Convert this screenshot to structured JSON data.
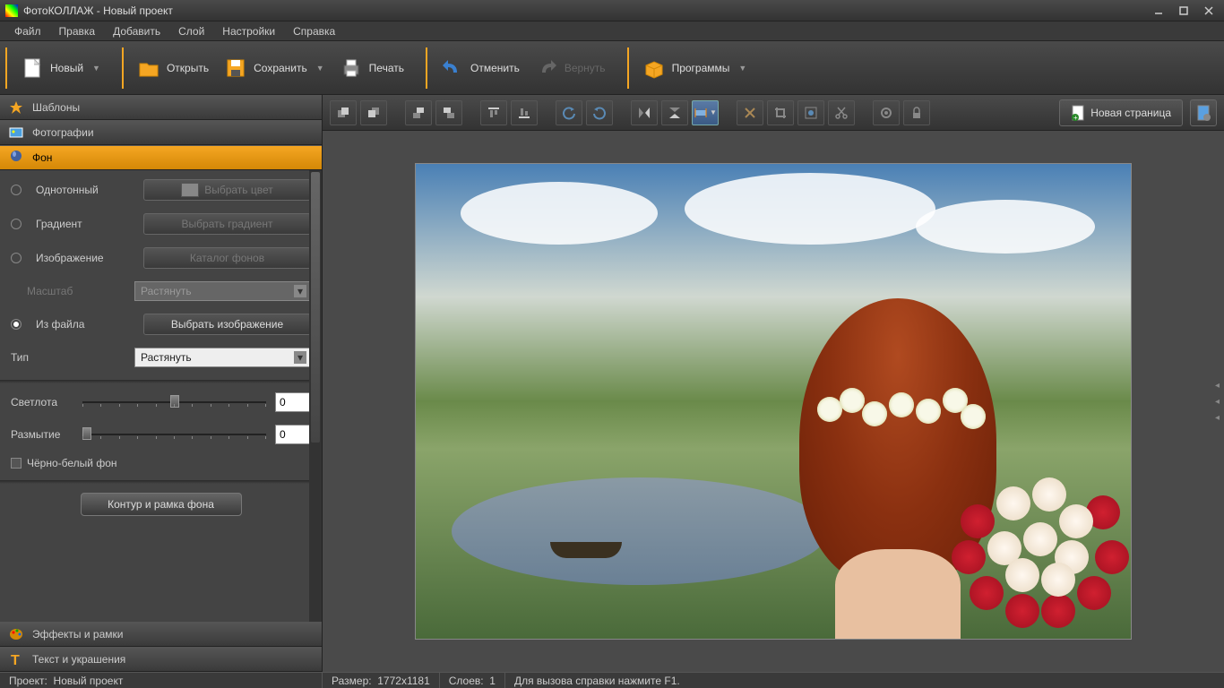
{
  "title": "ФотоКОЛЛАЖ - Новый проект",
  "menu": [
    "Файл",
    "Правка",
    "Добавить",
    "Слой",
    "Настройки",
    "Справка"
  ],
  "toolbar": {
    "new": "Новый",
    "open": "Открыть",
    "save": "Сохранить",
    "print": "Печать",
    "undo": "Отменить",
    "redo": "Вернуть",
    "programs": "Программы"
  },
  "panels": {
    "templates": "Шаблоны",
    "photos": "Фотографии",
    "background": "Фон",
    "effects": "Эффекты и рамки",
    "text": "Текст и украшения"
  },
  "bg": {
    "solid": "Однотонный",
    "pick_color": "Выбрать цвет",
    "gradient": "Градиент",
    "pick_gradient": "Выбрать градиент",
    "image": "Изображение",
    "catalog": "Каталог фонов",
    "scale": "Масштаб",
    "scale_val": "Растянуть",
    "from_file": "Из файла",
    "pick_image": "Выбрать изображение",
    "type": "Тип",
    "type_val": "Растянуть",
    "brightness": "Светлота",
    "brightness_val": "0",
    "blur": "Размытие",
    "blur_val": "0",
    "bw": "Чёрно-белый фон",
    "outline": "Контур и рамка фона"
  },
  "canvas_toolbar": {
    "new_page": "Новая страница"
  },
  "status": {
    "project_label": "Проект:",
    "project_val": "Новый проект",
    "size_label": "Размер:",
    "size_val": "1772x1181",
    "layers_label": "Слоев:",
    "layers_val": "1",
    "help": "Для вызова справки нажмите F1."
  }
}
